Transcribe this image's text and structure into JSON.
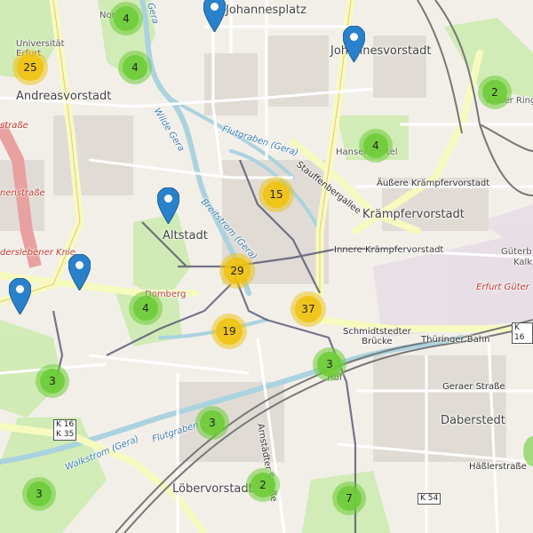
{
  "labels": {
    "andreasvorstadt": "Andreasvorstadt",
    "altstadt": "Altstadt",
    "kraempfervorstadt": "Krämpfervorstadt",
    "johannesvorstadt": "Johannesvorstadt",
    "johannesplatz": "Johannesplatz",
    "loebervorstadt": "Löbervorstadt",
    "daberstedt": "Daberstedt",
    "hansenviertel": "Hansenviertel",
    "aeussere_kraempfer": "Äußere Krämpfervorstadt",
    "innere_kraempfer": "Innere Krämpfervorstadt",
    "stauffenbergallee": "Stauffenbergallee",
    "flutgraben_gera": "Flutgraben (Gera)",
    "breitstrom": "Breitstrom (Gera)",
    "wilde_gera": "Wilde Gera",
    "walkstrom": "Walkstrom (Gera)",
    "flutgraben": "Flutgraben",
    "gera_top": "Gera",
    "nordhaeuser": "Nor",
    "universitaet": "Universität\nErfurt",
    "strasse_left": "straße",
    "nenstrasse": "nenstraße",
    "binderslebener": "derslebener Knie",
    "domberg": "Domberg",
    "schmidtstedter": "Schmidtstedter\nBrücke",
    "thueringer_bahn": "Thüringer Bahn",
    "hbf": "Hbf",
    "erfurt_gueter": "Erfurt Güter",
    "gueterbf": "Güterb",
    "kalk": "Kalk",
    "aeussere_ringe": "Äußer Ringe",
    "geraer_strasse": "Geraer Straße",
    "haesslerstrasse": "Häßlerstraße",
    "arnstaedter": "Arnstädter Straße",
    "k16_k35": "K 16\nK 35",
    "k54": "K 54",
    "k16_right": "K 16"
  },
  "clusters": [
    {
      "id": "c1",
      "count": "4",
      "color": "green"
    },
    {
      "id": "c2",
      "count": "4",
      "color": "green"
    },
    {
      "id": "c3",
      "count": "25",
      "color": "yellow"
    },
    {
      "id": "c4",
      "count": "2",
      "color": "green"
    },
    {
      "id": "c5",
      "count": "4",
      "color": "green"
    },
    {
      "id": "c6",
      "count": "15",
      "color": "yellow"
    },
    {
      "id": "c7",
      "count": "29",
      "color": "yellow"
    },
    {
      "id": "c8",
      "count": "37",
      "color": "yellow"
    },
    {
      "id": "c9",
      "count": "4",
      "color": "green"
    },
    {
      "id": "c10",
      "count": "19",
      "color": "yellow"
    },
    {
      "id": "c11",
      "count": "3",
      "color": "green"
    },
    {
      "id": "c12",
      "count": "3",
      "color": "green"
    },
    {
      "id": "c13",
      "count": "3",
      "color": "green"
    },
    {
      "id": "c14",
      "count": "3",
      "color": "green"
    },
    {
      "id": "c15",
      "count": "2",
      "color": "green"
    },
    {
      "id": "c16",
      "count": "7",
      "color": "green"
    }
  ],
  "colors": {
    "marker": "#2a81cb",
    "cluster_green": "#6ecc39",
    "cluster_yellow": "#f0c20c"
  }
}
